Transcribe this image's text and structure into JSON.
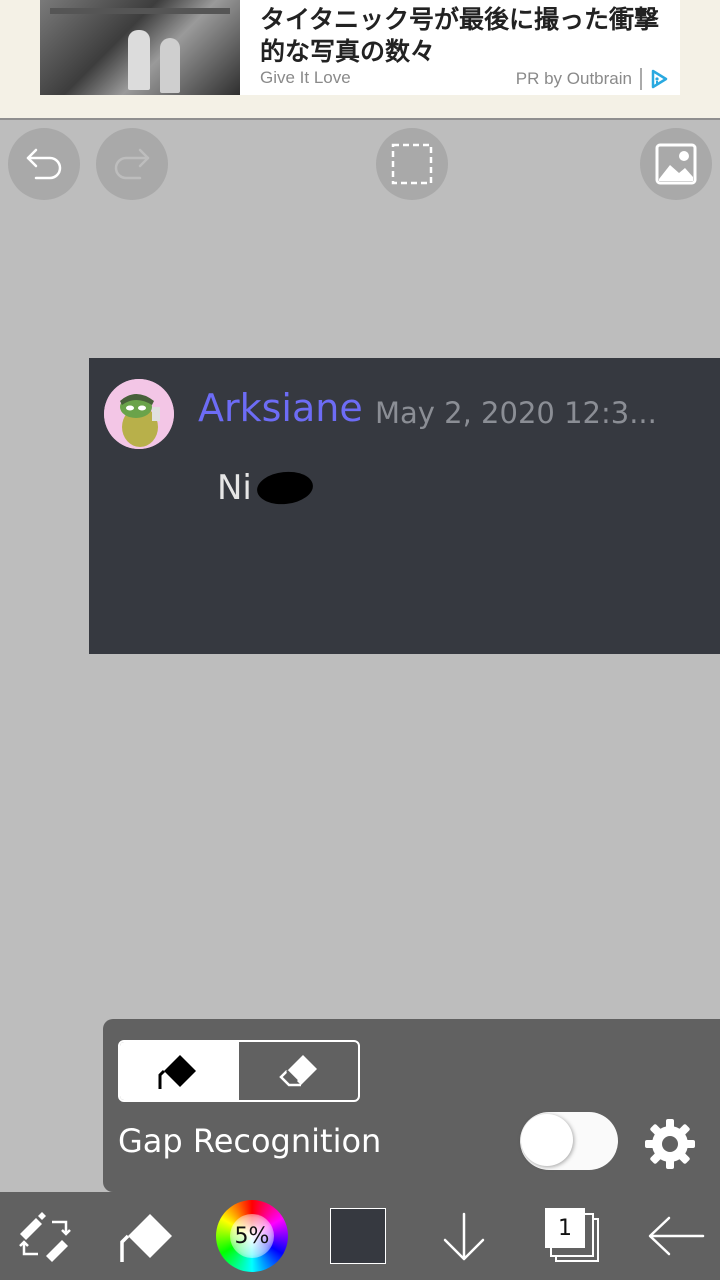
{
  "ad": {
    "title": "タイタニック号が最後に撮った衝撃的な写真の数々",
    "source": "Give It Love",
    "pr_label": "PR by Outbrain"
  },
  "toolbar": {
    "icons": [
      "undo-icon",
      "redo-icon",
      "selection-icon",
      "image-icon"
    ]
  },
  "canvas": {
    "username": "Arksiane",
    "timestamp": "May 2, 2020 12:3...",
    "message": "Ni",
    "background_color": "#363940",
    "username_color": "#6d6cf5"
  },
  "tool_panel": {
    "modes": [
      "fill-icon",
      "eraser-icon"
    ],
    "selected_mode": "fill",
    "gap_recognition_label": "Gap Recognition",
    "gap_recognition_on": false
  },
  "bottom_bar": {
    "brush_opacity": "5%",
    "current_color": "#363940",
    "layer_count": "1",
    "icons": [
      "transform-icon",
      "fill-tool-icon",
      "color-wheel-icon",
      "color-swatch",
      "download-icon",
      "layers-icon",
      "back-arrow-icon"
    ]
  }
}
